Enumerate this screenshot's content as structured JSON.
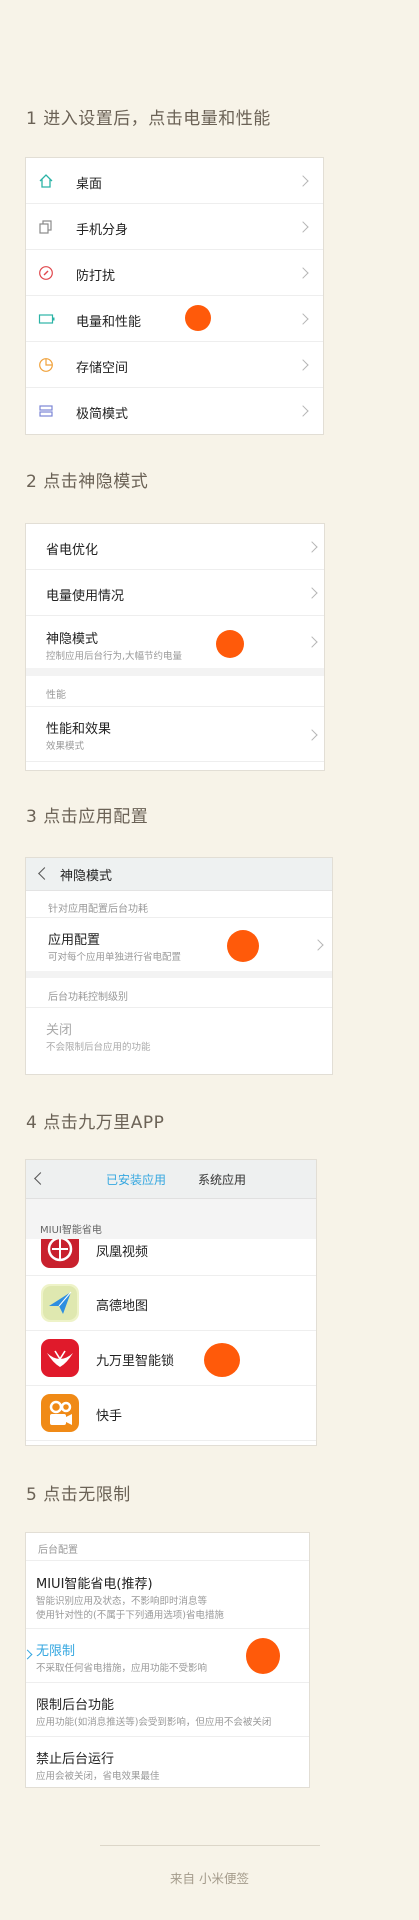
{
  "steps": {
    "s1": "1 进入设置后，点击电量和性能",
    "s2": "2 点击神隐模式",
    "s3": "3 点击应用配置",
    "s4": "4 点击九万里APP",
    "s5": "5  点击无限制"
  },
  "settings": {
    "items": [
      {
        "label": "桌面",
        "icon": "home-icon",
        "color": "#2bb3a6"
      },
      {
        "label": "手机分身",
        "icon": "clone-icon",
        "color": "#8a8a8a"
      },
      {
        "label": "防打扰",
        "icon": "compass-icon",
        "color": "#e0474c"
      },
      {
        "label": "电量和性能",
        "icon": "battery-icon",
        "color": "#2bb3a6"
      },
      {
        "label": "存储空间",
        "icon": "pie-icon",
        "color": "#f0a23c"
      },
      {
        "label": "极简模式",
        "icon": "layers-icon",
        "color": "#7b86d6"
      }
    ]
  },
  "battery": {
    "items": [
      {
        "label": "省电优化",
        "sub": ""
      },
      {
        "label": "电量使用情况",
        "sub": ""
      },
      {
        "label": "神隐模式",
        "sub": "控制应用后台行为,大幅节约电量"
      }
    ],
    "section": "性能",
    "perf": {
      "label": "性能和效果",
      "sub": "效果模式"
    }
  },
  "hidden_mode": {
    "title": "神隐模式",
    "hint": "针对应用配置后台功耗",
    "app_config": {
      "label": "应用配置",
      "sub": "可对每个应用单独进行省电配置"
    },
    "level_head": "后台功耗控制级别",
    "off": {
      "label": "关闭",
      "sub": "不会限制后台应用的功能"
    }
  },
  "apps": {
    "tab_installed": "已安装应用",
    "tab_system": "系统应用",
    "group": "MIUI智能省电",
    "list": [
      {
        "name": "凤凰视频"
      },
      {
        "name": "高德地图"
      },
      {
        "name": "九万里智能锁"
      },
      {
        "name": "快手"
      }
    ]
  },
  "bg_config": {
    "head": "后台配置",
    "options": [
      {
        "label": "MIUI智能省电(推荐)",
        "sub1": "智能识别应用及状态，不影响即时消息等",
        "sub2": "使用针对性的(不属于下列通用选项)省电措施"
      },
      {
        "label": "无限制",
        "sub1": "不采取任何省电措施，应用功能不受影响",
        "sub2": ""
      },
      {
        "label": "限制后台功能",
        "sub1": "应用功能(如消息推送等)会受到影响，但应用不会被关闭",
        "sub2": ""
      },
      {
        "label": "禁止后台运行",
        "sub1": "应用会被关闭，省电效果最佳",
        "sub2": ""
      }
    ]
  },
  "footer": "来自 小米便签",
  "accent": "#ff5a0a",
  "highlight": "#35a7e0"
}
